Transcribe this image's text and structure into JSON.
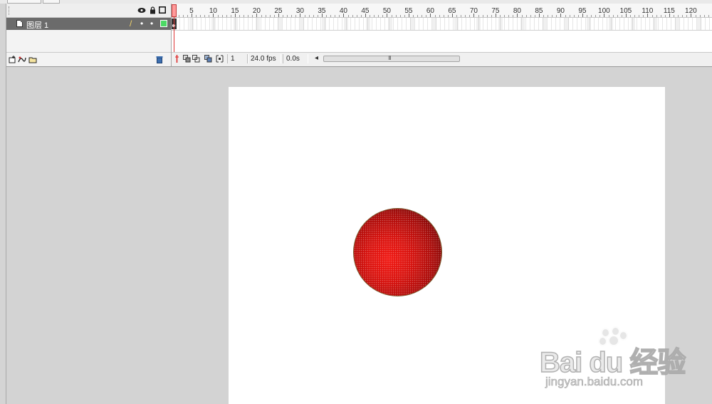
{
  "timeline": {
    "header_icons": {
      "eye": "eye-icon",
      "lock": "lock-icon",
      "outline": "square-outline-icon"
    },
    "layers": [
      {
        "name": "图层 1",
        "pencil": "pencil-icon",
        "visible_dot": "•",
        "lock_dot": "•",
        "outline_color": "#4cd964"
      }
    ],
    "footer_icons": [
      "new-layer-icon",
      "add-motion-guide-icon",
      "new-folder-icon",
      "delete-layer-icon"
    ],
    "ruler_labels": [
      "5",
      "10",
      "15",
      "20",
      "25",
      "30",
      "35",
      "40",
      "45",
      "50",
      "55",
      "60",
      "65",
      "70",
      "75",
      "80",
      "85",
      "90",
      "95",
      "100",
      "105",
      "110",
      "115",
      "120"
    ],
    "status": {
      "current_frame": "1",
      "frame_rate": "24.0 fps",
      "elapsed_time": "0.0s",
      "scroll_left": "◂",
      "scroll_grip": "III"
    }
  },
  "stage": {
    "background": "#ffffff",
    "shape_color": "#e01612"
  },
  "watermark": {
    "logo": "Bai du 经验",
    "url": "jingyan.baidu.com"
  }
}
